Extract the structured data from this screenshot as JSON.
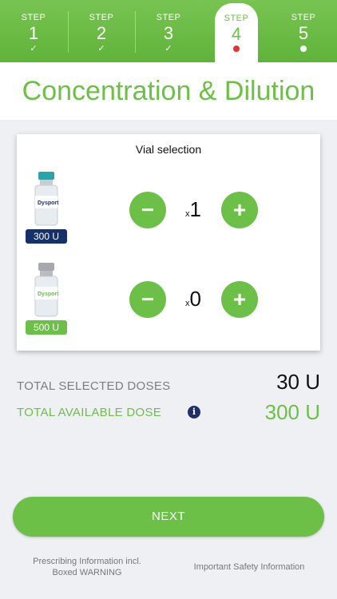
{
  "stepper": {
    "steps": [
      {
        "label": "STEP",
        "number": "1",
        "status": "done",
        "mark": "✓"
      },
      {
        "label": "STEP",
        "number": "2",
        "status": "done",
        "mark": "✓"
      },
      {
        "label": "STEP",
        "number": "3",
        "status": "done",
        "mark": "✓"
      },
      {
        "label": "STEP",
        "number": "4",
        "status": "current"
      },
      {
        "label": "STEP",
        "number": "5",
        "status": "upcoming"
      }
    ],
    "current_dot_color": "#e8302f",
    "upcoming_dot_color": "#ffffff"
  },
  "page": {
    "title": "Concentration & Dilution"
  },
  "vial_selection": {
    "title": "Vial selection",
    "vials": [
      {
        "badge": "300 U",
        "badge_color": "#16306b",
        "cap_color": "#2aa4a8",
        "brand": "Dysport",
        "quantity_prefix": "x",
        "quantity": "1",
        "minus": "−",
        "plus": "+"
      },
      {
        "badge": "500 U",
        "badge_color": "#6cbf47",
        "cap_color": "#a5a9ad",
        "brand": "Dysport",
        "quantity_prefix": "x",
        "quantity": "0",
        "minus": "−",
        "plus": "+"
      }
    ]
  },
  "totals": {
    "selected_label": "TOTAL SELECTED DOSES",
    "selected_value": "30 U",
    "available_label": "TOTAL AVAILABLE DOSE",
    "available_value": "300 U",
    "info_glyph": "i"
  },
  "actions": {
    "next_label": "NEXT"
  },
  "footer": {
    "prescribing_line1": "Prescribing Information incl.",
    "prescribing_line2": "Boxed WARNING",
    "safety": "Important Safety Information"
  },
  "colors": {
    "accent": "#6cbf47",
    "navy": "#1e2f6b",
    "label_gray": "#7b7d86"
  }
}
